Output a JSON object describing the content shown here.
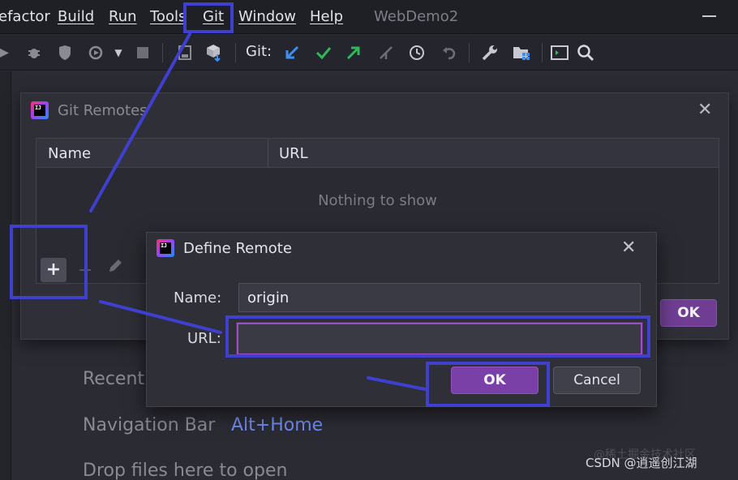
{
  "menubar": {
    "items": [
      "efactor",
      "Build",
      "Run",
      "Tools",
      "Git",
      "Window",
      "Help"
    ],
    "window_title": "WebDemo2"
  },
  "toolbar": {
    "git_label": "Git:",
    "icons": [
      "run-icon",
      "debug-icon",
      "coverage-icon",
      "profile-icon",
      "dropdown-icon",
      "stop-icon",
      "build-icon",
      "deploy-icon",
      "git-update-icon",
      "git-commit-icon",
      "git-push-icon",
      "git-merge-icon",
      "git-history-icon",
      "git-rollback-icon",
      "settings-wrench-icon",
      "project-structure-icon",
      "terminal-icon",
      "search-icon"
    ],
    "icon_colors": {
      "update": "#3d8ff0",
      "commit": "#2fb85a",
      "push": "#2fb85a"
    }
  },
  "background": {
    "hint_recent": "Recent",
    "hint_nav": "Navigation Bar",
    "hint_nav_key": "Alt+Home",
    "hint_drop": "Drop files here to open",
    "watermark": "CSDN @逍遥创江湖",
    "watermark_sub": "@稀土掘金技术社区"
  },
  "git_remotes": {
    "title": "Git Remotes",
    "columns": [
      "Name",
      "URL"
    ],
    "empty_text": "Nothing to show",
    "add_label": "+",
    "remove_label": "−",
    "ok_label": "OK"
  },
  "define_remote": {
    "title": "Define Remote",
    "name_label": "Name:",
    "name_value": "origin",
    "url_label": "URL:",
    "url_value": "",
    "ok_label": "OK",
    "cancel_label": "Cancel"
  },
  "colors": {
    "annotation": "#3f3fd0",
    "accent": "#7b3fa8",
    "focus_border": "#9a4fc7"
  }
}
